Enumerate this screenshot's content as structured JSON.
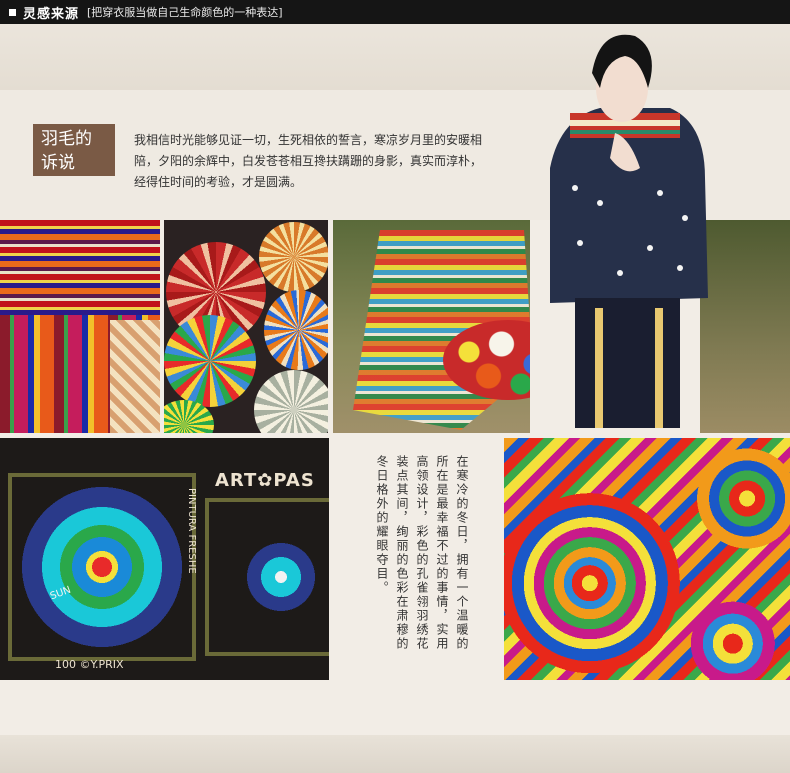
{
  "header": {
    "title": "灵感来源",
    "subtitle": "[把穿衣服当做自己生命颜色的一种表达]"
  },
  "tag": {
    "line1": "羽毛的",
    "line2": "诉说"
  },
  "intro": "我相信时光能够见证一切，生死相依的誓言，寒凉岁月里的安暖相陪，夕阳的余辉中，白发苍苍相互搀扶蹒跚的身影，真实而淳朴，经得住时间的考验，才是圆满。",
  "vertical_text": "在寒冷的冬日，拥有一个温暖的所在是最幸福不过的事情，实用高领设计，彩色的孔雀翎羽绣花装点其间，绚丽的色彩在肃穆的冬日格外的耀眼夺目。",
  "art_words": {
    "art_label": "ART✿PAS",
    "pintura": "PINTURA FRESHE",
    "prix": "100 ©Y.PRIX",
    "sun": "SUN"
  }
}
